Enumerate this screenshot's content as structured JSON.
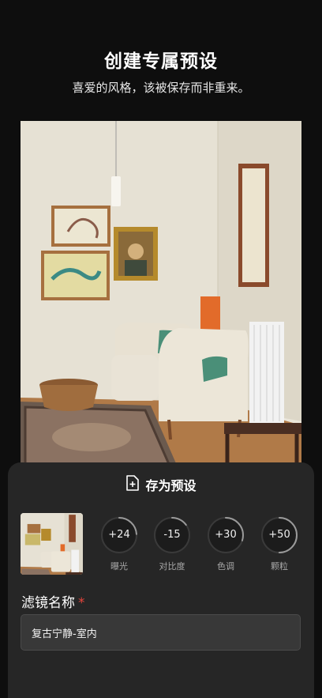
{
  "header": {
    "title": "创建专属预设",
    "subtitle": "喜爱的风格，该被保存而非重来。"
  },
  "photo": {
    "description_icon": "interior-room-photo"
  },
  "sheet": {
    "save_label": "存为预设",
    "save_icon": "add-file-icon",
    "adjustments": [
      {
        "value": "+24",
        "label": "曝光",
        "level": 0.24
      },
      {
        "value": "-15",
        "label": "对比度",
        "level": 0.15
      },
      {
        "value": "+30",
        "label": "色调",
        "level": 0.3
      },
      {
        "value": "+50",
        "label": "颗粒",
        "level": 0.5
      }
    ],
    "name_label": "滤镜名称",
    "required_mark": "*",
    "name_value": "复古宁静-室内"
  },
  "colors": {
    "required": "#e5443b",
    "ring_track": "#3a3a3a",
    "ring_progress": "#9a9a9a"
  }
}
